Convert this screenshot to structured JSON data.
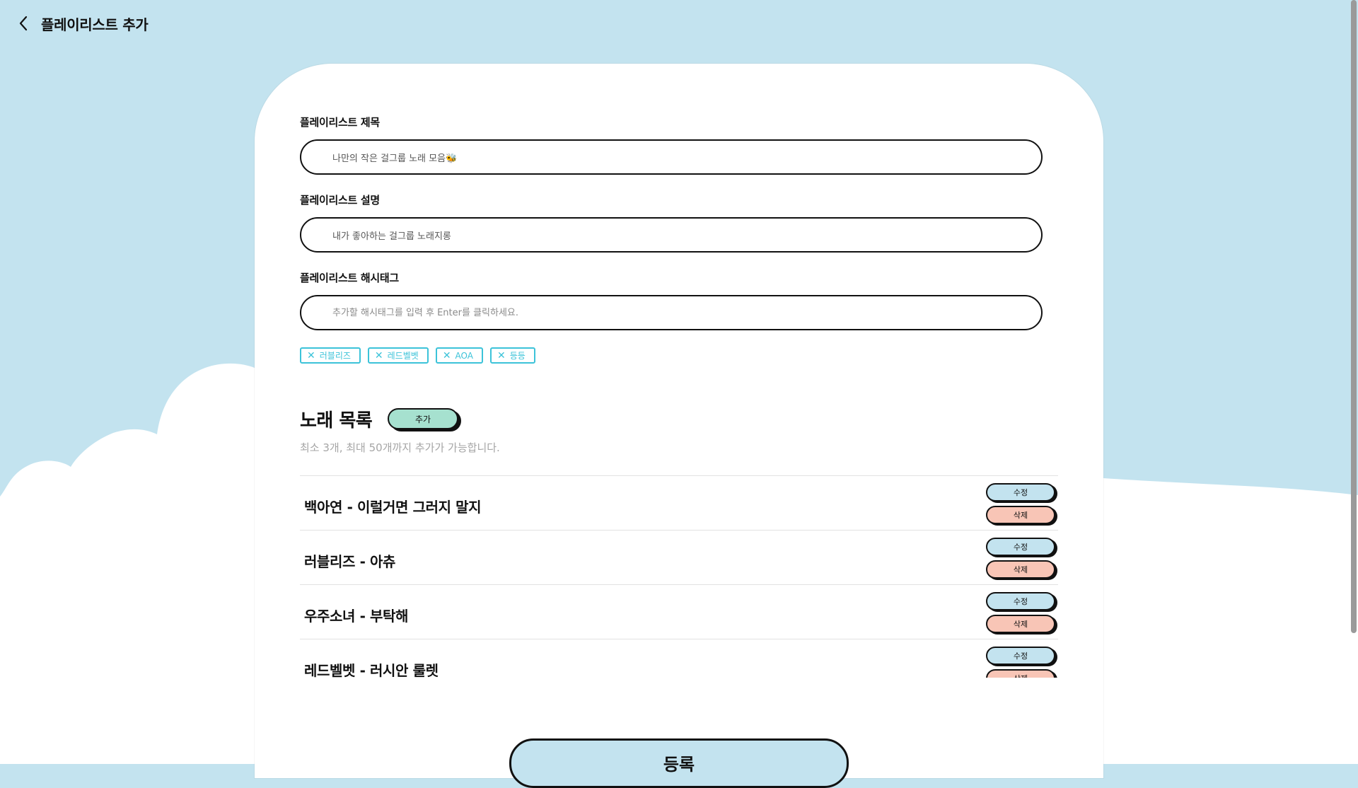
{
  "header": {
    "title": "플레이리스트 추가"
  },
  "form": {
    "title_label": "플레이리스트 제목",
    "title_value": "나만의 작은 걸그룹 노래 모음🐝",
    "description_label": "플레이리스트 설명",
    "description_value": "내가 좋아하는 걸그룹 노래지롱",
    "hashtag_label": "플레이리스트 해시태그",
    "hashtag_placeholder": "추가할 해시태그를 입력 후 Enter를 클릭하세요."
  },
  "tags": [
    "러블리즈",
    "레드벨벳",
    "AOA",
    "등등"
  ],
  "songs": {
    "section_title": "노래 목록",
    "add_label": "추가",
    "hint": "최소 3개, 최대 50개까지 추가가 가능합니다.",
    "edit_label": "수정",
    "delete_label": "삭제",
    "items": [
      "백아연 - 이럴거면 그러지 말지",
      "러블리즈 - 아츄",
      "우주소녀 - 부탁해",
      "레드벨벳 - 러시안 룰렛"
    ]
  },
  "submit_label": "등록",
  "colors": {
    "sky": "#c3e3ef",
    "tag_accent": "#3cc3d9",
    "add_button": "#a6e1cf",
    "delete_button": "#f8c5b6"
  }
}
